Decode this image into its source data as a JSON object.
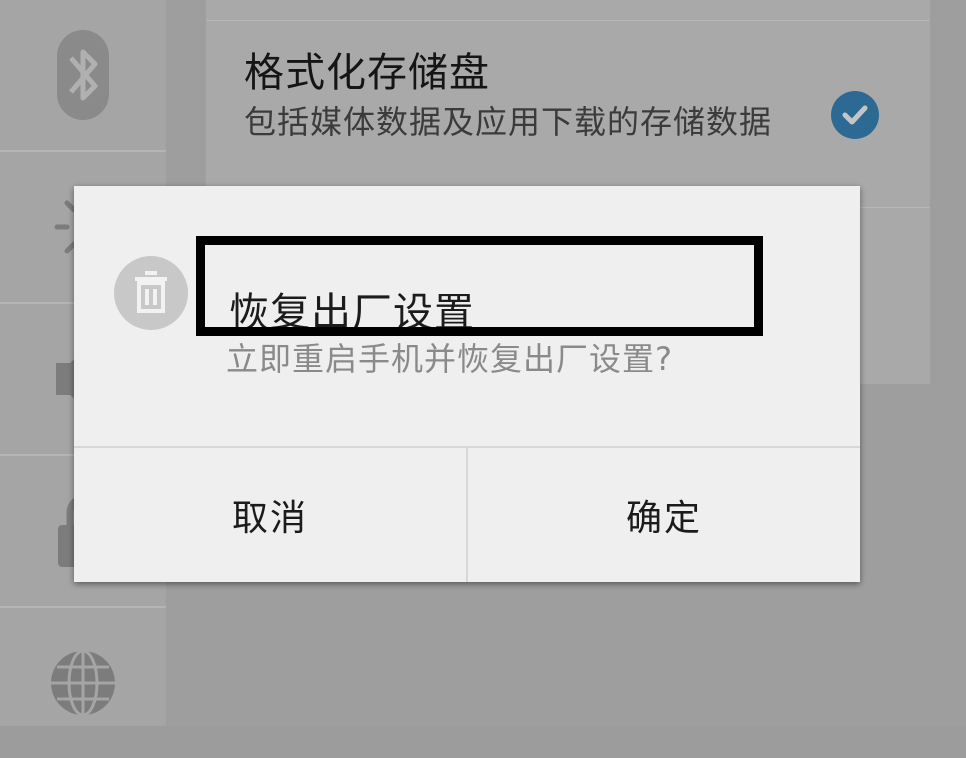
{
  "sidebar": {
    "items": [
      {
        "icon": "bluetooth-icon"
      },
      {
        "icon": "brightness-icon"
      },
      {
        "icon": "volume-icon"
      },
      {
        "icon": "lock-icon"
      },
      {
        "icon": "globe-icon"
      }
    ]
  },
  "option": {
    "title": "格式化存储盘",
    "description": "包括媒体数据及应用下载的存储数据",
    "checked": true,
    "check_color": "#2c6a93"
  },
  "dialog": {
    "icon": "trash-icon",
    "title": "恢复出厂设置",
    "message": "立即重启手机并恢复出厂设置?",
    "cancel_label": "取消",
    "confirm_label": "确定",
    "highlight_color": "#000000"
  }
}
